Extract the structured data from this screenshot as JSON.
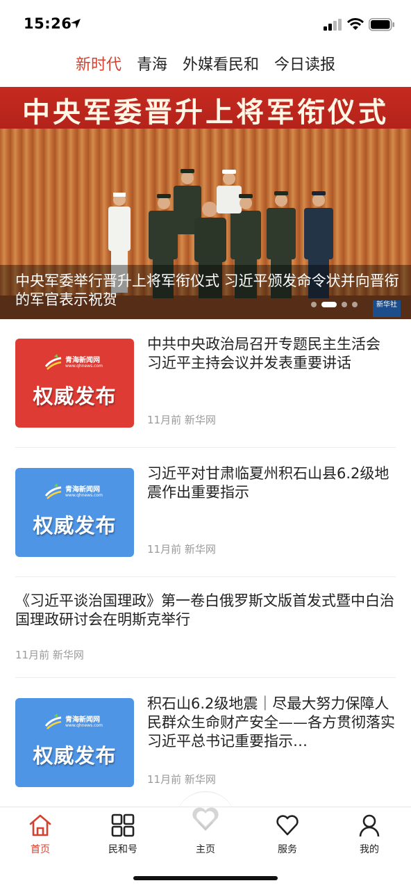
{
  "status_bar": {
    "time": "15:26"
  },
  "tabs": [
    {
      "label": "新时代",
      "active": true
    },
    {
      "label": "青海",
      "active": false
    },
    {
      "label": "外媒看民和",
      "active": false
    },
    {
      "label": "今日读报",
      "active": false
    }
  ],
  "banner": {
    "headline": "中央军委晋升上将军衔仪式",
    "caption": "中央军委举行晋升上将军衔仪式 习近平颁发命令状并向晋衔的军官表示祝贺",
    "source_logo": "新华社",
    "slides_count": 4,
    "active_slide": 1
  },
  "thumb_common": {
    "logo_text": "青海新闻网",
    "logo_sub": "www.qhnews.com",
    "label": "权威发布"
  },
  "news": [
    {
      "title": "中共中央政治局召开专题民主生活会 习近平主持会议并发表重要讲话",
      "time": "11月前",
      "source": "新华网",
      "thumb_color": "#dd3b33"
    },
    {
      "title": "习近平对甘肃临夏州积石山县6.2级地震作出重要指示",
      "time": "11月前",
      "source": "新华网",
      "thumb_color": "#4f95e6"
    },
    {
      "title": "《习近平谈治国理政》第一卷白俄罗斯文版首发式暨中白治国理政研讨会在明斯克举行",
      "time": "11月前",
      "source": "新华网"
    },
    {
      "title": "积石山6.2级地震｜尽最大努力保障人民群众生命财产安全——各方贯彻落实习近平总书记重要指示…",
      "time": "11月前",
      "source": "新华网",
      "thumb_color": "#4f95e6"
    }
  ],
  "bottom_nav": [
    {
      "label": "首页",
      "icon": "home-icon",
      "active": true
    },
    {
      "label": "民和号",
      "icon": "grid-icon",
      "active": false
    },
    {
      "label": "主页",
      "icon": "heart-logo-icon",
      "active": false
    },
    {
      "label": "服务",
      "icon": "heart-outline-icon",
      "active": false
    },
    {
      "label": "我的",
      "icon": "user-icon",
      "active": false
    }
  ],
  "colors": {
    "accent": "#d6402f",
    "thumb_red": "#dd3b33",
    "thumb_blue": "#4f95e6",
    "meta_gray": "#9a9a9a"
  }
}
